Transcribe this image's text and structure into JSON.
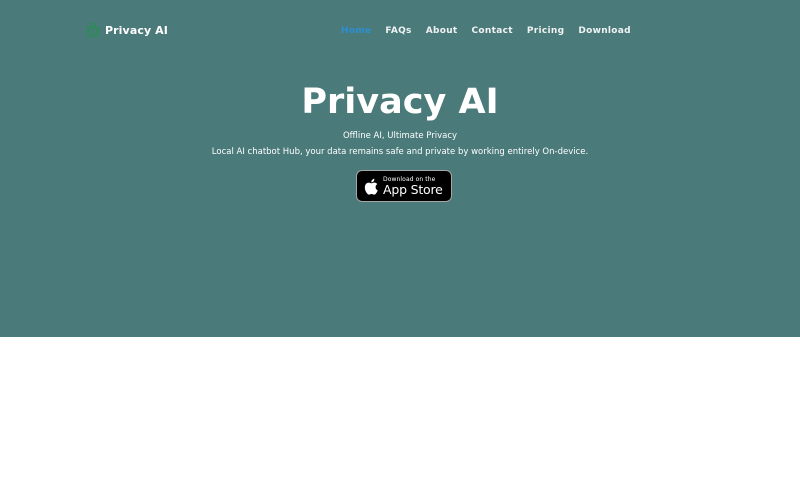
{
  "brand": {
    "name": "Privacy AI",
    "icon": "bug-icon",
    "icon_color": "#2e8b57"
  },
  "nav": {
    "items": [
      {
        "label": "Home",
        "active": true
      },
      {
        "label": "FAQs",
        "active": false
      },
      {
        "label": "About",
        "active": false
      },
      {
        "label": "Contact",
        "active": false
      },
      {
        "label": "Pricing",
        "active": false
      },
      {
        "label": "Download",
        "active": false
      }
    ]
  },
  "hero": {
    "title": "Privacy AI",
    "tagline": "Offline AI, Ultimate Privacy",
    "subtitle": "Local AI chatbot Hub, your data remains safe and private by working entirely On-device.",
    "background": "#4a7a79"
  },
  "appstore": {
    "small_label": "Download on the",
    "big_label": "App Store",
    "icon": "apple-icon"
  },
  "colors": {
    "accent": "#2b8fd4",
    "hero_bg": "#4a7a79"
  }
}
